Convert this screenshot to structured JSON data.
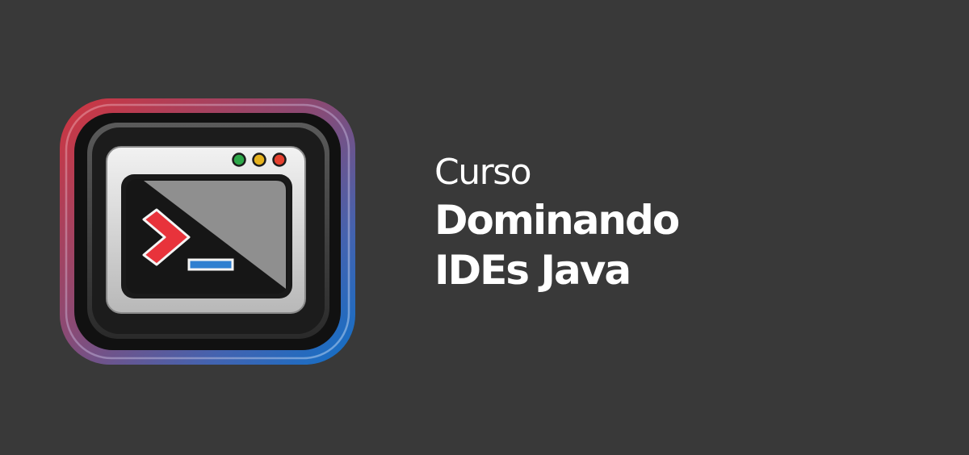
{
  "colors": {
    "background": "#393939",
    "text": "#ffffff",
    "frame_gradient": [
      "#d0353f",
      "#8a4a74",
      "#3e66b8",
      "#1070c8"
    ],
    "prompt_chevron": "#e8333b",
    "cursor_bar": "#2f7fd0",
    "light_green": "#2ea84a",
    "light_yellow": "#e6b21e",
    "light_red": "#e5402f"
  },
  "icons": {
    "logo": "terminal-window-icon"
  },
  "title": {
    "kicker": "Curso",
    "line1": "Dominando",
    "line2": "IDEs Java"
  }
}
